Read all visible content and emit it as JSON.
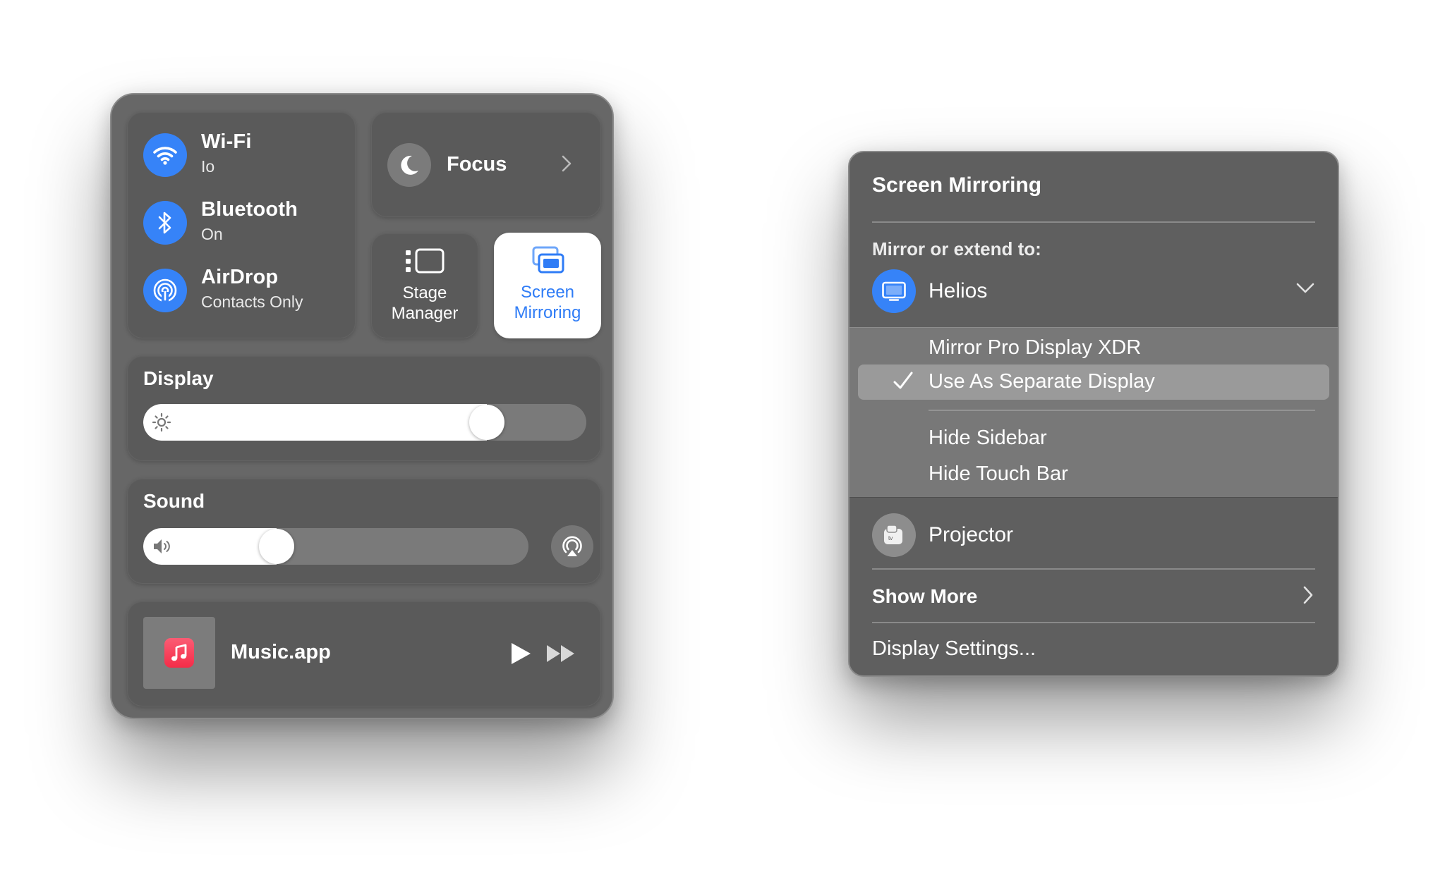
{
  "control_center": {
    "network": {
      "wifi": {
        "title": "Wi-Fi",
        "subtitle": "Io",
        "icon": "wifi-icon"
      },
      "bluetooth": {
        "title": "Bluetooth",
        "subtitle": "On",
        "icon": "bluetooth-icon"
      },
      "airdrop": {
        "title": "AirDrop",
        "subtitle": "Contacts Only",
        "icon": "airdrop-icon"
      }
    },
    "focus": {
      "label": "Focus",
      "icon": "moon-icon"
    },
    "stage_manager": {
      "line1": "Stage",
      "line2": "Manager",
      "icon": "stage-manager-icon"
    },
    "screen_mirroring": {
      "line1": "Screen",
      "line2": "Mirroring",
      "icon": "screen-mirroring-icon",
      "active": true
    },
    "display": {
      "label": "Display",
      "brightness": 0.8
    },
    "sound": {
      "label": "Sound",
      "volume": 0.33
    },
    "now_playing": {
      "label": "Music.app",
      "icon": "music-note-icon"
    }
  },
  "mirroring_menu": {
    "title": "Screen Mirroring",
    "subheading": "Mirror or extend to:",
    "devices": [
      {
        "name": "Helios",
        "icon": "display-icon",
        "expanded": true
      },
      {
        "name": "Projector",
        "icon": "apple-tv-icon"
      }
    ],
    "options": [
      {
        "label": "Mirror Pro Display XDR",
        "checked": false
      },
      {
        "label": "Use As Separate Display",
        "checked": true
      }
    ],
    "extra_options": [
      {
        "label": "Hide Sidebar"
      },
      {
        "label": "Hide Touch Bar"
      }
    ],
    "show_more": "Show More",
    "display_settings": "Display Settings..."
  },
  "colors": {
    "accent": "#3683f8",
    "panel": "#676767",
    "tile": "#5a5a5a",
    "highlight": "#9a9a9a"
  }
}
